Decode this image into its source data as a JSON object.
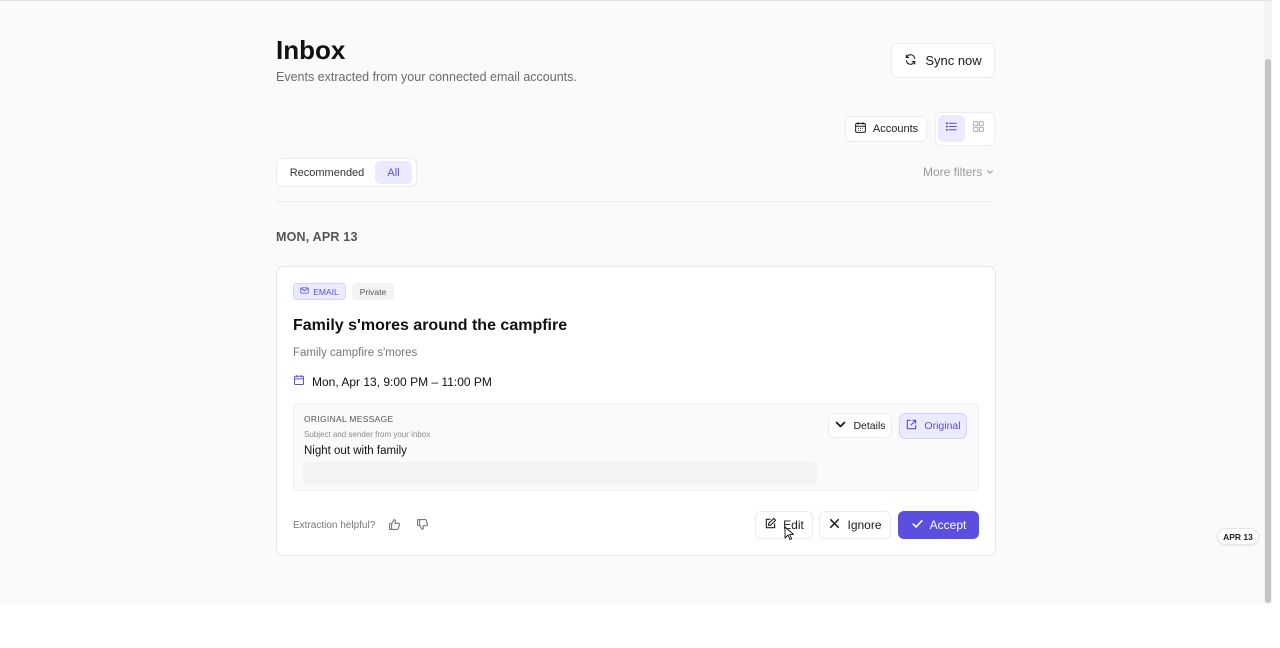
{
  "header": {
    "title": "Inbox",
    "subtitle": "Events extracted from your connected email accounts.",
    "sync_label": "Sync now"
  },
  "toolbar": {
    "accounts_label": "Accounts",
    "view_modes": [
      "list-icon",
      "grid-icon"
    ],
    "active_view": "list"
  },
  "filters": {
    "tabs": [
      {
        "label": "Recommended",
        "active": false
      },
      {
        "label": "All",
        "active": true
      }
    ],
    "more_filters_label": "More filters"
  },
  "groups": [
    {
      "date_label": "MON, APR 13",
      "events": [
        {
          "source_badge": "EMAIL",
          "visibility_badge": "Private",
          "title": "Family s'mores around the campfire",
          "description": "Family campfire s'mores",
          "time": "Mon, Apr 13, 9:00 PM – 11:00 PM",
          "original_message": {
            "label": "ORIGINAL MESSAGE",
            "hint": "Subject and sender from your inbox",
            "subject": "Night out with family",
            "details_label": "Details",
            "original_label": "Original"
          },
          "feedback_label": "Extraction helpful?",
          "actions": {
            "edit": "Edit",
            "ignore": "Ignore",
            "accept": "Accept"
          }
        }
      ]
    }
  ],
  "date_indicator": "APR 13",
  "colors": {
    "accent": "#5b4fe0",
    "accent_soft": "#ebeaff",
    "background": "#fafafa"
  }
}
